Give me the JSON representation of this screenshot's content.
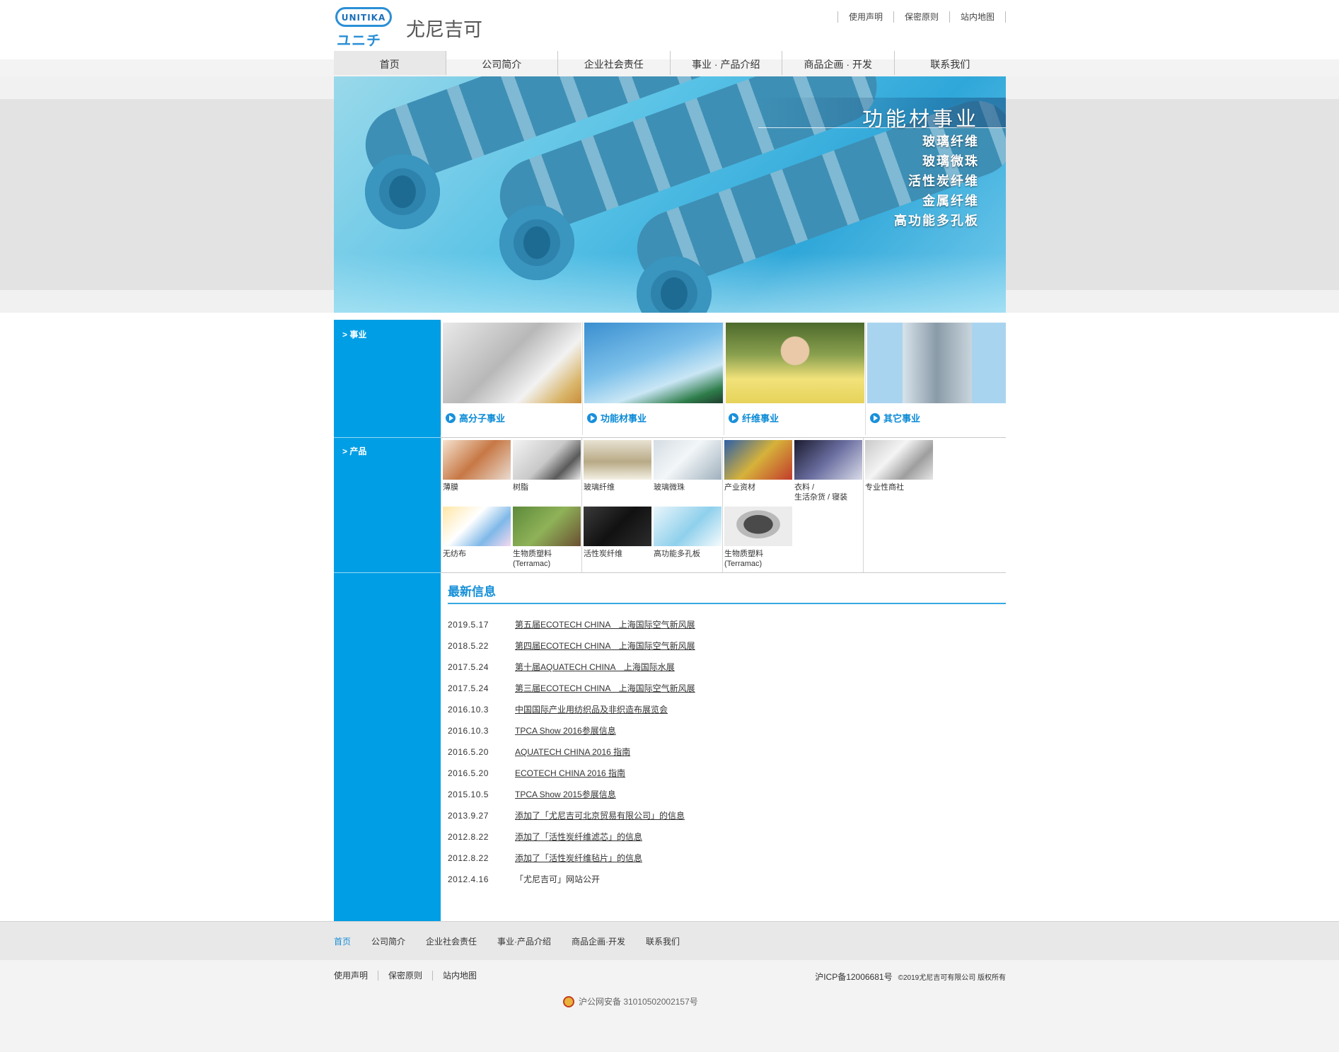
{
  "header": {
    "logo_en": "UNITIKA",
    "logo_kana": "ユニチカ",
    "brand": "尤尼吉可",
    "top_links": [
      "使用声明",
      "保密原则",
      "站内地图"
    ]
  },
  "nav": [
    "首页",
    "公司简介",
    "企业社会责任",
    "事业 · 产品介绍",
    "商品企画 · 开发",
    "联系我们"
  ],
  "hero": {
    "title": "功能材事业",
    "items": [
      "玻璃纤维",
      "玻璃微珠",
      "活性炭纤维",
      "金属纤维",
      "高功能多孔板"
    ]
  },
  "sections": {
    "business": "> 事业",
    "products": "> 产品"
  },
  "business_cards": [
    {
      "label": "高分子事业"
    },
    {
      "label": "功能材事业"
    },
    {
      "label": "纤维事业"
    },
    {
      "label": "其它事业"
    }
  ],
  "products": {
    "col1": [
      {
        "label": "薄膜"
      },
      {
        "label": "树脂"
      },
      {
        "label": "无纺布"
      },
      {
        "label": "生物质塑料\n(Terramac)"
      }
    ],
    "col2": [
      {
        "label": "玻璃纤维"
      },
      {
        "label": "玻璃微珠"
      },
      {
        "label": "活性炭纤维"
      },
      {
        "label": "高功能多孔板"
      }
    ],
    "col3": [
      {
        "label": "产业资材"
      },
      {
        "label": "衣料 /\n生活杂货 / 寝装"
      },
      {
        "label": "生物质塑料\n(Terramac)"
      }
    ],
    "col4": [
      {
        "label": "专业性商社"
      }
    ]
  },
  "news": {
    "title": "最新信息",
    "items": [
      {
        "date": "2019.5.17",
        "text": "第五届ECOTECH CHINA　上海国际空气新风展",
        "link": true
      },
      {
        "date": "2018.5.22",
        "text": "第四届ECOTECH CHINA　上海国际空气新风展",
        "link": true
      },
      {
        "date": "2017.5.24",
        "text": "第十届AQUATECH CHINA　上海国际水展",
        "link": true
      },
      {
        "date": "2017.5.24",
        "text": "第三届ECOTECH CHINA　上海国际空气新风展",
        "link": true
      },
      {
        "date": "2016.10.3",
        "text": "中国国际产业用纺织品及非织造布展览会",
        "link": true
      },
      {
        "date": "2016.10.3",
        "text": "TPCA Show 2016参展信息",
        "link": true
      },
      {
        "date": "2016.5.20",
        "text": "AQUATECH CHINA 2016 指南",
        "link": true
      },
      {
        "date": "2016.5.20",
        "text": "ECOTECH CHINA 2016 指南",
        "link": true
      },
      {
        "date": "2015.10.5",
        "text": "TPCA Show 2015参展信息",
        "link": true
      },
      {
        "date": "2013.9.27",
        "text": "添加了「尤尼吉可北京贸易有限公司」的信息",
        "link": true
      },
      {
        "date": "2012.8.22",
        "text": "添加了「活性炭纤维滤芯」的信息",
        "link": true
      },
      {
        "date": "2012.8.22",
        "text": "添加了「活性炭纤维毡片」的信息",
        "link": true
      },
      {
        "date": "2012.4.16",
        "text": "「尤尼吉可」网站公开",
        "link": false
      }
    ]
  },
  "footer": {
    "nav": [
      "首页",
      "公司简介",
      "企业社会责任",
      "事业·产品介绍",
      "商品企画·开发",
      "联系我们"
    ],
    "links": [
      "使用声明",
      "保密原则",
      "站内地图"
    ],
    "icp": "沪ICP备12006681号",
    "copyright": "©2019尤尼吉可有限公司 版权所有",
    "police": "沪公网安备 31010502002157号"
  }
}
